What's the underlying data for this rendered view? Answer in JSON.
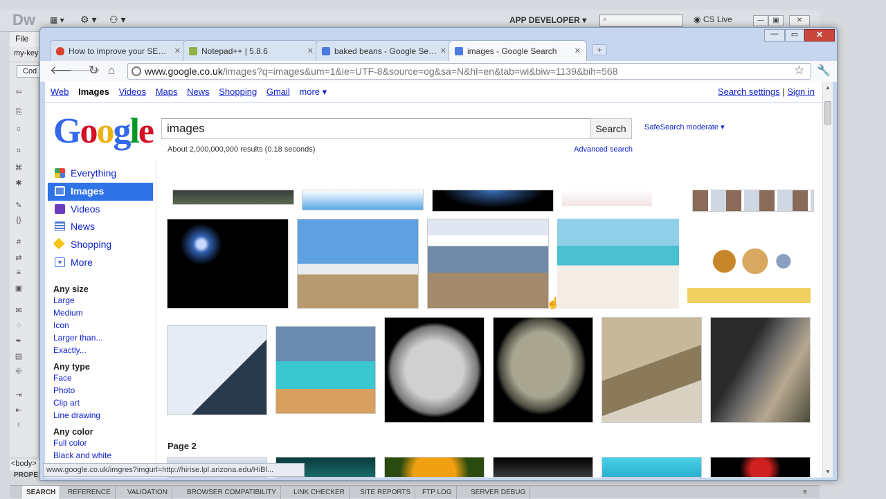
{
  "dreamweaver": {
    "logo": "Dw",
    "file_menu": "File",
    "doc_tab": "my-key",
    "code_button": "Cod",
    "workspace": "APP DEVELOPER",
    "search_placeholder": "",
    "cs_live": "CS Live",
    "body_tag": "<body>",
    "properties": "PROPE",
    "bottom_tabs": [
      "SEARCH",
      "REFERENCE",
      "VALIDATION",
      "BROWSER COMPATIBILITY",
      "LINK CHECKER",
      "SITE REPORTS",
      "FTP LOG",
      "SERVER DEBUG"
    ]
  },
  "chrome": {
    "tabs": [
      {
        "title": "How to improve your SE…",
        "favicon_color": "#d9432d"
      },
      {
        "title": "Notepad++ | 5.8.6",
        "favicon_color": "#8fb24a"
      },
      {
        "title": "baked beans - Google Se…",
        "favicon_color": "#4a7be0"
      },
      {
        "title": "images - Google Search",
        "favicon_color": "#4a7be0"
      }
    ],
    "url_host": "www.google.co.uk",
    "url_path": "/images?q=images&um=1&ie=UTF-8&source=og&sa=N&hl=en&tab=wi&biw=1139&bih=568",
    "status_url": "www.google.co.uk/imgres?imgurl=http://hirise.lpl.arizona.edu/HiBl..."
  },
  "google": {
    "topbar_links": [
      "Web",
      "Images",
      "Videos",
      "Maps",
      "News",
      "Shopping",
      "Gmail",
      "more ▾"
    ],
    "search_settings": "Search settings",
    "separator": "|",
    "sign_in": "Sign in",
    "logo_letters": [
      {
        "ch": "G",
        "color": "#3369e8"
      },
      {
        "ch": "o",
        "color": "#d50f25"
      },
      {
        "ch": "o",
        "color": "#eeb211"
      },
      {
        "ch": "g",
        "color": "#3369e8"
      },
      {
        "ch": "l",
        "color": "#009925"
      },
      {
        "ch": "e",
        "color": "#d50f25"
      }
    ],
    "query": "images",
    "search_button": "Search",
    "safesearch": "SafeSearch moderate ▾",
    "result_stats": "About 2,000,000,000 results (0.18 seconds)",
    "advanced_search": "Advanced search",
    "left_nav": [
      {
        "label": "Everything",
        "icon_color": "#e8433a"
      },
      {
        "label": "Images",
        "icon_color": "#5a86e0"
      },
      {
        "label": "Videos",
        "icon_color": "#6a3cc0"
      },
      {
        "label": "News",
        "icon_color": "#4a7bd0"
      },
      {
        "label": "Shopping",
        "icon_color": "#f5c518"
      },
      {
        "label": "More",
        "icon_color": "#3a6fd8"
      }
    ],
    "filters": [
      {
        "heading": "Any size",
        "options": [
          "Large",
          "Medium",
          "Icon",
          "Larger than...",
          "Exactly..."
        ]
      },
      {
        "heading": "Any type",
        "options": [
          "Face",
          "Photo",
          "Clip art",
          "Line drawing"
        ]
      },
      {
        "heading": "Any color",
        "options": [
          "Full color",
          "Black and white"
        ]
      }
    ],
    "page2_label": "Page 2"
  }
}
